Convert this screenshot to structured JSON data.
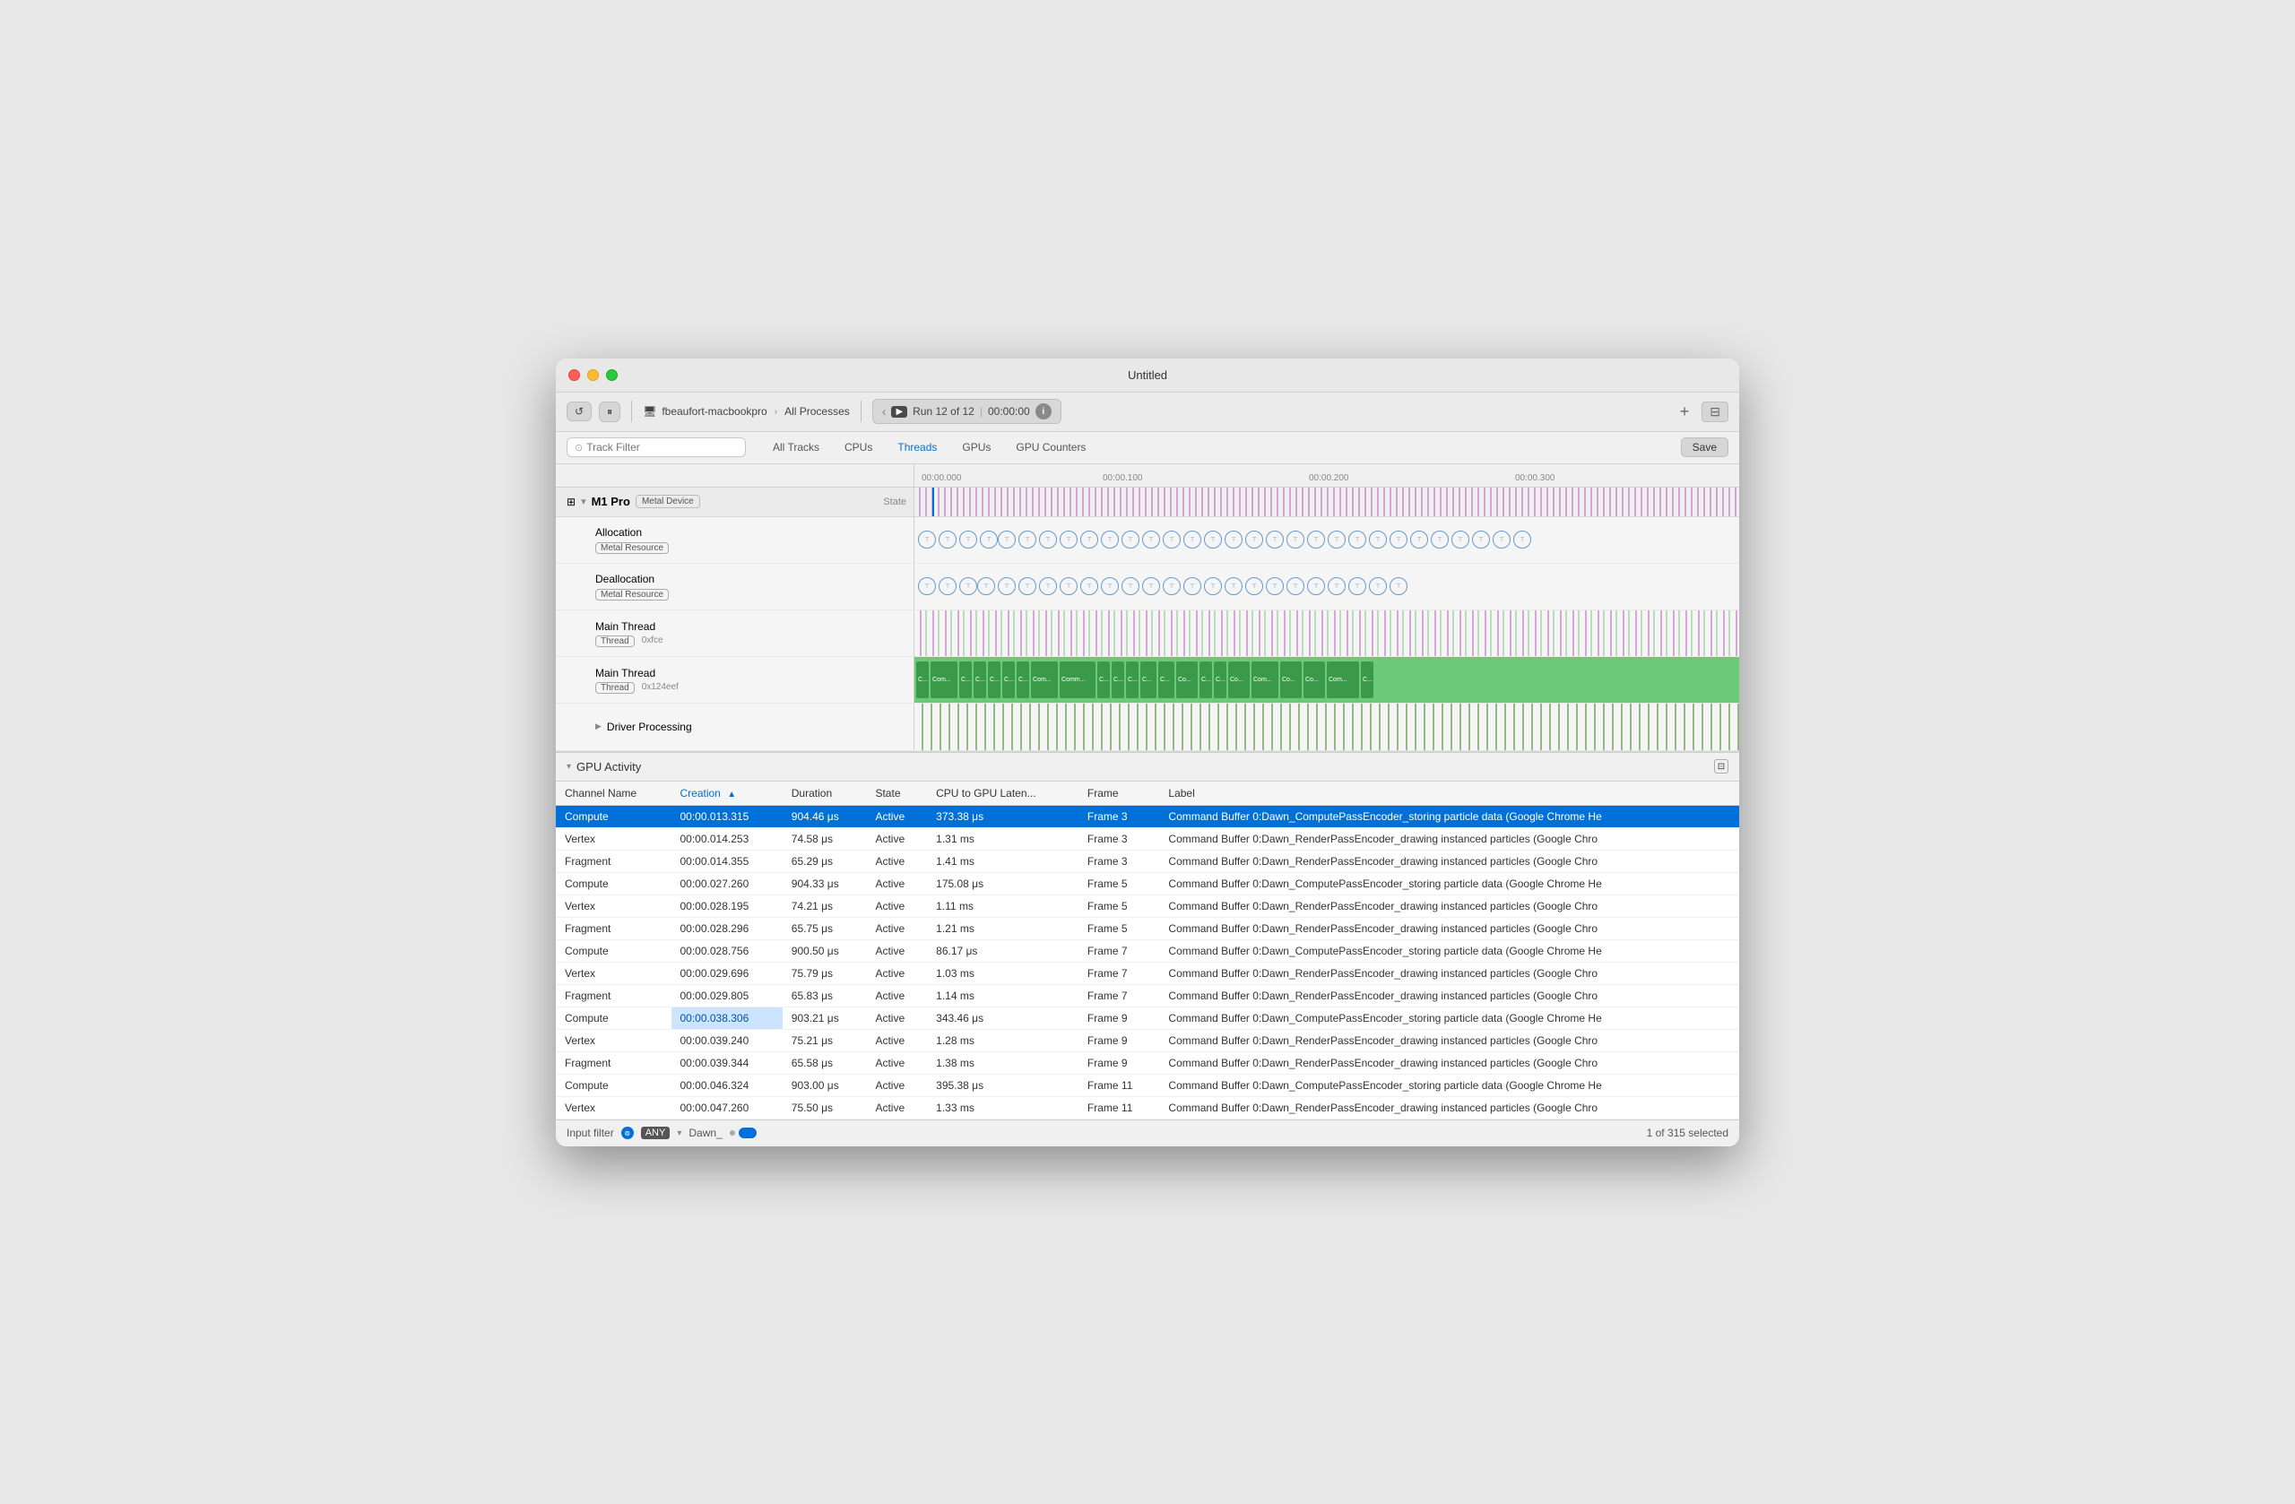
{
  "window": {
    "title": "Untitled"
  },
  "toolbar": {
    "device": "fbeaufort-macbookpro",
    "all_processes": "All Processes",
    "run_label": "Run 12 of 12",
    "time": "00:00:00",
    "plus": "+",
    "save_label": "Save"
  },
  "nav_tabs": {
    "filter_placeholder": "Track Filter",
    "tabs": [
      "All Tracks",
      "CPUs",
      "Threads",
      "GPUs",
      "GPU Counters"
    ],
    "active_tab": "Threads",
    "save": "Save"
  },
  "tracks": {
    "section": "M1 Pro",
    "section_badge": "Metal Device",
    "state_label": "State",
    "rows": [
      {
        "name": "Allocation",
        "badge": "Metal Resource",
        "indent": 1
      },
      {
        "name": "Deallocation",
        "badge": "Metal Resource",
        "indent": 1
      },
      {
        "name": "Main Thread",
        "badge": "Thread",
        "badge2": "0xfce",
        "indent": 1
      },
      {
        "name": "Main Thread",
        "badge": "Thread",
        "badge2": "0x124eef",
        "indent": 1
      },
      {
        "name": "Driver Processing",
        "indent": 1,
        "has_expand": true
      }
    ]
  },
  "gpu_activity": {
    "title": "GPU Activity",
    "columns": [
      {
        "key": "channel",
        "label": "Channel Name"
      },
      {
        "key": "creation",
        "label": "Creation",
        "sorted": true,
        "sort_dir": "asc"
      },
      {
        "key": "duration",
        "label": "Duration"
      },
      {
        "key": "state",
        "label": "State"
      },
      {
        "key": "cpu_gpu_lat",
        "label": "CPU to GPU Laten..."
      },
      {
        "key": "frame",
        "label": "Frame"
      },
      {
        "key": "label",
        "label": "Label"
      }
    ],
    "rows": [
      {
        "channel": "Compute",
        "creation": "00:00.013.315",
        "duration": "904.46 μs",
        "state": "Active",
        "cpu_gpu_lat": "373.38 μs",
        "frame": "Frame 3",
        "label": "Command Buffer 0:Dawn_ComputePassEncoder_storing particle data   (Google Chrome He",
        "selected": true
      },
      {
        "channel": "Vertex",
        "creation": "00:00.014.253",
        "duration": "74.58 μs",
        "state": "Active",
        "cpu_gpu_lat": "1.31 ms",
        "frame": "Frame 3",
        "label": "Command Buffer 0:Dawn_RenderPassEncoder_drawing instanced particles   (Google Chro"
      },
      {
        "channel": "Fragment",
        "creation": "00:00.014.355",
        "duration": "65.29 μs",
        "state": "Active",
        "cpu_gpu_lat": "1.41 ms",
        "frame": "Frame 3",
        "label": "Command Buffer 0:Dawn_RenderPassEncoder_drawing instanced particles   (Google Chro"
      },
      {
        "channel": "Compute",
        "creation": "00:00.027.260",
        "duration": "904.33 μs",
        "state": "Active",
        "cpu_gpu_lat": "175.08 μs",
        "frame": "Frame 5",
        "label": "Command Buffer 0:Dawn_ComputePassEncoder_storing particle data   (Google Chrome He"
      },
      {
        "channel": "Vertex",
        "creation": "00:00.028.195",
        "duration": "74.21 μs",
        "state": "Active",
        "cpu_gpu_lat": "1.11 ms",
        "frame": "Frame 5",
        "label": "Command Buffer 0:Dawn_RenderPassEncoder_drawing instanced particles   (Google Chro"
      },
      {
        "channel": "Fragment",
        "creation": "00:00.028.296",
        "duration": "65.75 μs",
        "state": "Active",
        "cpu_gpu_lat": "1.21 ms",
        "frame": "Frame 5",
        "label": "Command Buffer 0:Dawn_RenderPassEncoder_drawing instanced particles   (Google Chro"
      },
      {
        "channel": "Compute",
        "creation": "00:00.028.756",
        "duration": "900.50 μs",
        "state": "Active",
        "cpu_gpu_lat": "86.17 μs",
        "frame": "Frame 7",
        "label": "Command Buffer 0:Dawn_ComputePassEncoder_storing particle data   (Google Chrome He"
      },
      {
        "channel": "Vertex",
        "creation": "00:00.029.696",
        "duration": "75.79 μs",
        "state": "Active",
        "cpu_gpu_lat": "1.03 ms",
        "frame": "Frame 7",
        "label": "Command Buffer 0:Dawn_RenderPassEncoder_drawing instanced particles   (Google Chro"
      },
      {
        "channel": "Fragment",
        "creation": "00:00.029.805",
        "duration": "65.83 μs",
        "state": "Active",
        "cpu_gpu_lat": "1.14 ms",
        "frame": "Frame 7",
        "label": "Command Buffer 0:Dawn_RenderPassEncoder_drawing instanced particles   (Google Chro"
      },
      {
        "channel": "Compute",
        "creation": "00:00.038.306",
        "duration": "903.21 μs",
        "state": "Active",
        "cpu_gpu_lat": "343.46 μs",
        "frame": "Frame 9",
        "label": "Command Buffer 0:Dawn_ComputePassEncoder_storing particle data   (Google Chrome He",
        "highlight_creation": true
      },
      {
        "channel": "Vertex",
        "creation": "00:00.039.240",
        "duration": "75.21 μs",
        "state": "Active",
        "cpu_gpu_lat": "1.28 ms",
        "frame": "Frame 9",
        "label": "Command Buffer 0:Dawn_RenderPassEncoder_drawing instanced particles   (Google Chro"
      },
      {
        "channel": "Fragment",
        "creation": "00:00.039.344",
        "duration": "65.58 μs",
        "state": "Active",
        "cpu_gpu_lat": "1.38 ms",
        "frame": "Frame 9",
        "label": "Command Buffer 0:Dawn_RenderPassEncoder_drawing instanced particles   (Google Chro"
      },
      {
        "channel": "Compute",
        "creation": "00:00.046.324",
        "duration": "903.00 μs",
        "state": "Active",
        "cpu_gpu_lat": "395.38 μs",
        "frame": "Frame 11",
        "label": "Command Buffer 0:Dawn_ComputePassEncoder_storing particle data   (Google Chrome He"
      },
      {
        "channel": "Vertex",
        "creation": "00:00.047.260",
        "duration": "75.50 μs",
        "state": "Active",
        "cpu_gpu_lat": "1.33 ms",
        "frame": "Frame 11",
        "label": "Command Buffer 0:Dawn_RenderPassEncoder_drawing instanced particles   (Google Chro"
      }
    ]
  },
  "status_bar": {
    "filter_label": "Input filter",
    "any_label": "ANY",
    "filter_value": "Dawn_",
    "count_label": "1 of 315 selected"
  },
  "ruler": {
    "marks": [
      "00:00.000",
      "00:00.100",
      "00:00.200",
      "00:00.300"
    ]
  }
}
